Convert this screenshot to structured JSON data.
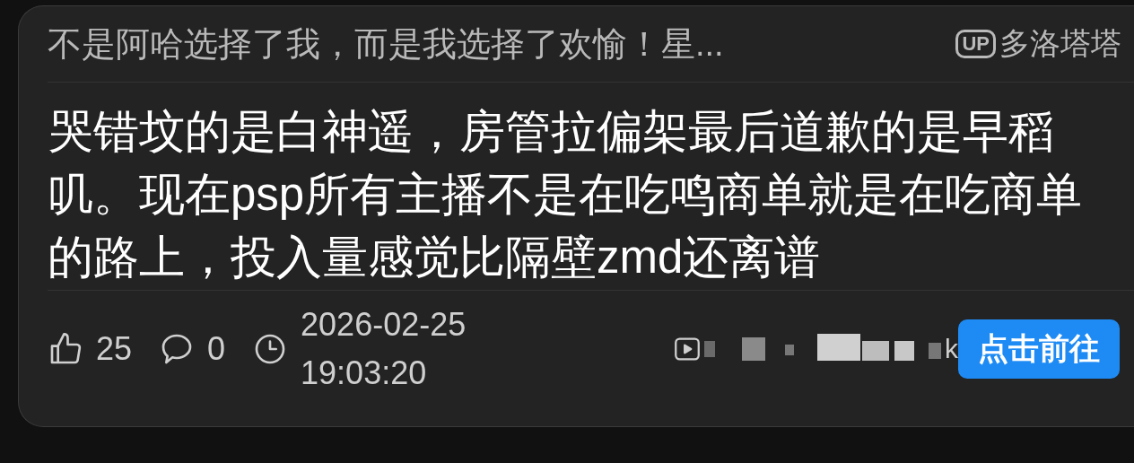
{
  "post": {
    "title": "不是阿哈选择了我，而是我选择了欢愉！星...",
    "up_badge": "UP",
    "author": "多洛塔塔",
    "body": "哭错坟的是白神遥，房管拉偏架最后道歉的是早稻叽。现在psp所有主播不是在吃鸣商单就是在吃商单的路上，投入量感觉比隔壁zmd还离谱",
    "likes": "25",
    "comments": "0",
    "date": "2026-02-25",
    "time": "19:03:20",
    "source_tail": "k",
    "button": "点击前往"
  }
}
